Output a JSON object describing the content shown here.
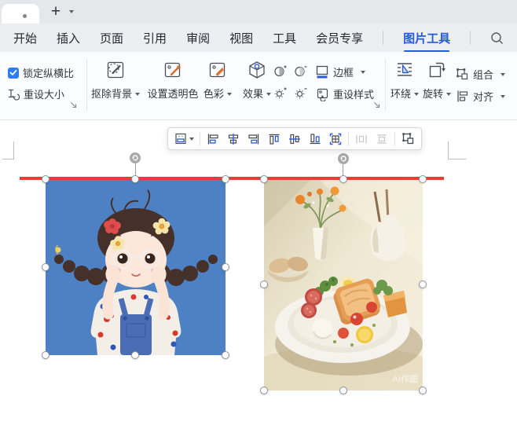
{
  "colors": {
    "accent_blue": "#2759dd",
    "checkbox_blue": "#2e7cf5",
    "icon_blue": "#2b5bd7",
    "icon_orange": "#d96a2c",
    "red_line": "#ee3b36",
    "girl_image_bg": "#4d81c4",
    "food_image_bg": "#efe8d2"
  },
  "titlebar": {
    "new_tab": "+",
    "tab_indicator": "unsaved-dot"
  },
  "menubar": {
    "items": [
      "开始",
      "插入",
      "页面",
      "引用",
      "审阅",
      "视图",
      "工具",
      "会员专享"
    ],
    "active_tab": "图片工具",
    "search_icon": "magnifier"
  },
  "ribbon": {
    "size_group": {
      "lock_aspect": "锁定纵横比",
      "lock_aspect_checked": true,
      "reset_size": "重设大小"
    },
    "adjust_group": {
      "remove_background": "抠除背景",
      "set_transparent_color": "设置透明色",
      "color": "色彩",
      "effects": "效果",
      "border": "边框",
      "reset_style": "重设样式"
    },
    "arrange_group": {
      "wrap": "环绕",
      "rotate": "旋转",
      "group": "组合",
      "align": "对齐"
    }
  },
  "quick_toolbar": {
    "icons": [
      "layout-options",
      "align-left",
      "align-center-horizontal",
      "align-right",
      "align-top",
      "align-middle-vertical",
      "align-bottom",
      "grid-align",
      "distribute-horizontal",
      "distribute-vertical",
      "group"
    ],
    "disabled_icons": [
      "distribute-horizontal",
      "distribute-vertical"
    ]
  },
  "canvas": {
    "shapes": [
      "red-horizontal-line"
    ],
    "girl_image_description": "cartoon girl with braided pigtails, flowers in hair, glasses, blue background",
    "food_image_description": "breakfast plate with toast, sausage, egg, vegetables, vase of orange flowers",
    "food_watermark": "AI作图"
  }
}
